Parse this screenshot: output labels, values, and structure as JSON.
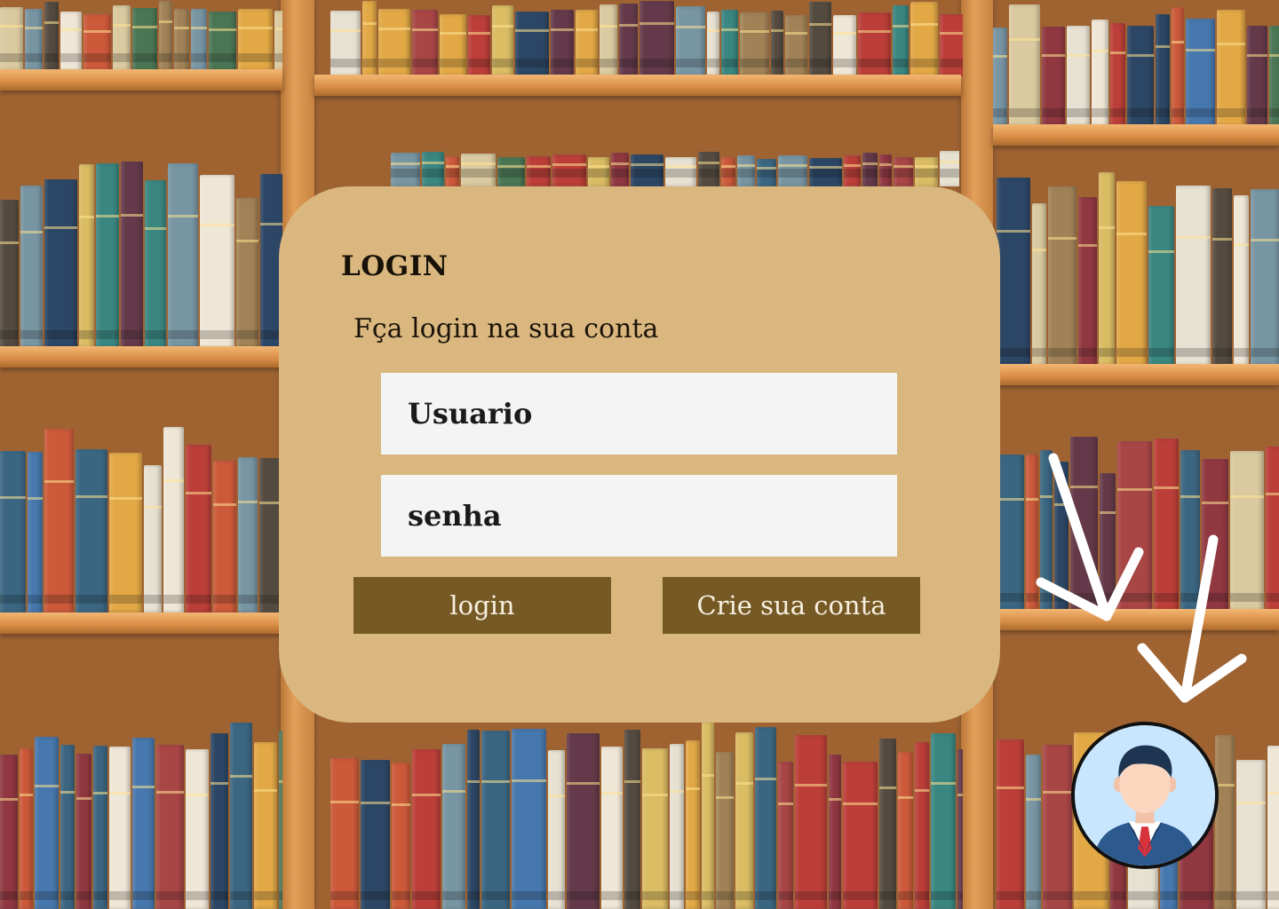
{
  "login_card": {
    "title": "LOGIN",
    "subtitle": "Fça login na sua conta",
    "username_placeholder": "Usuario",
    "password_placeholder": "senha",
    "login_button": "login",
    "signup_button": "Crie sua conta"
  },
  "icons": {
    "avatar": "user-avatar-icon",
    "arrows": "arrow-down-icon"
  },
  "colors": {
    "card_background": "#d9b77f",
    "button_background": "#765a25",
    "button_text": "#f7efe0",
    "input_background": "#f4f4f4",
    "avatar_background": "#c9e6ff"
  }
}
